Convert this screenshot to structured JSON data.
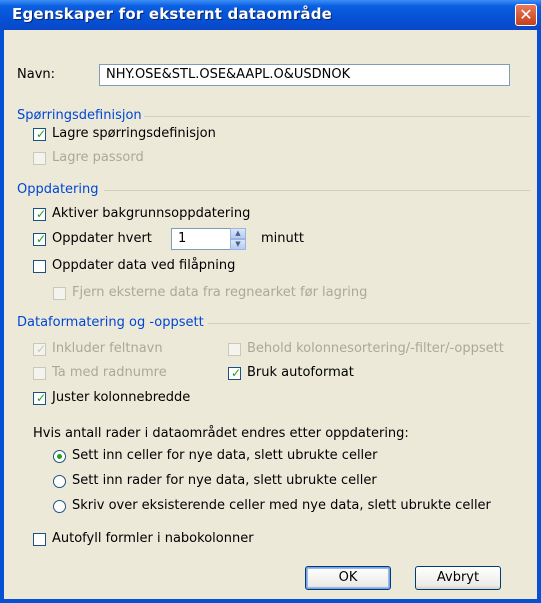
{
  "window": {
    "title": "Egenskaper for eksternt dataområde",
    "close_glyph": "✕"
  },
  "name_field": {
    "label": "Navn:",
    "value": "NHY.OSE&STL.OSE&AAPL.O&USDNOK"
  },
  "query_definition": {
    "group_label": "Spørringsdefinisjon",
    "save_query": {
      "label": "Lagre spørringsdefinisjon",
      "checked": true,
      "enabled": true
    },
    "save_password": {
      "label": "Lagre passord",
      "checked": false,
      "enabled": false
    }
  },
  "refresh": {
    "group_label": "Oppdatering",
    "background": {
      "label": "Aktiver bakgrunnsoppdatering",
      "checked": true
    },
    "every": {
      "label": "Oppdater hvert",
      "value": "1",
      "unit": "minutt",
      "checked": true
    },
    "on_open": {
      "label": "Oppdater data ved filåpning",
      "checked": false
    },
    "remove_data": {
      "label": "Fjern eksterne data fra regnearket før lagring",
      "checked": false,
      "enabled": false
    }
  },
  "formatting": {
    "group_label": "Dataformatering og -oppsett",
    "field_names": {
      "label": "Inkluder feltnavn",
      "checked": true,
      "enabled": false
    },
    "row_numbers": {
      "label": "Ta med radnumre",
      "checked": false,
      "enabled": false
    },
    "column_width": {
      "label": "Juster kolonnebredde",
      "checked": true
    },
    "keep_sort": {
      "label": "Behold kolonnesortering/-filter/-oppsett",
      "checked": false,
      "enabled": false
    },
    "autoformat": {
      "label": "Bruk autoformat",
      "checked": true
    }
  },
  "row_change": {
    "prompt": "Hvis antall rader i dataområdet endres etter oppdatering:",
    "options": [
      {
        "label": "Sett inn celler for nye data, slett ubrukte celler",
        "selected": true
      },
      {
        "label": "Sett inn rader for nye data, slett ubrukte celler",
        "selected": false
      },
      {
        "label": "Skriv over eksisterende celler med nye data, slett ubrukte celler",
        "selected": false
      }
    ]
  },
  "fill_formulas": {
    "label": "Autofyll formler i nabokolonner",
    "checked": false
  },
  "buttons": {
    "ok": "OK",
    "cancel": "Avbryt"
  },
  "glyphs": {
    "check": "✓",
    "spin_up": "▲",
    "spin_down": "▼"
  }
}
